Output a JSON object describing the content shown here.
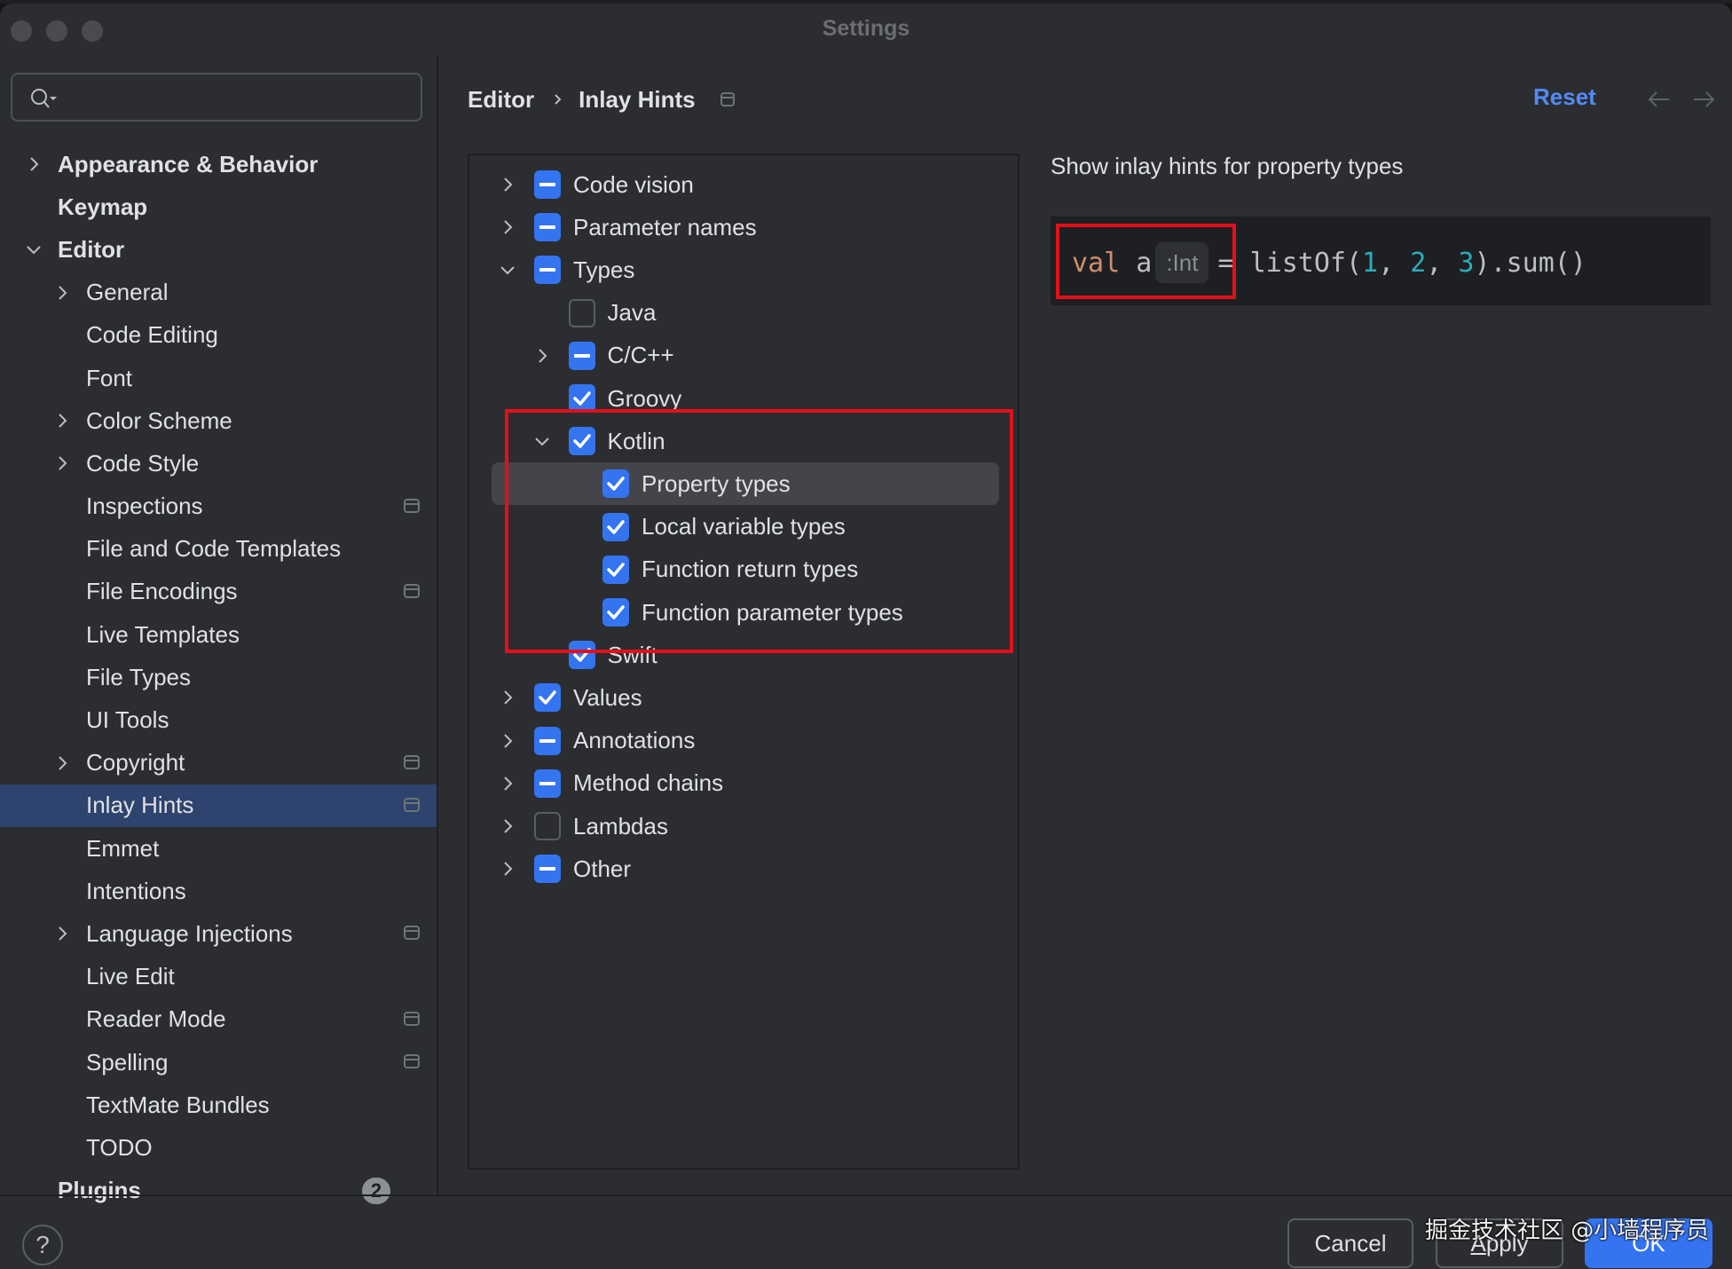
{
  "window": {
    "title": "Settings"
  },
  "search": {
    "value": "",
    "placeholder": ""
  },
  "sidebar": {
    "items": [
      {
        "label": "Appearance & Behavior",
        "level": 0,
        "bold": true,
        "expander": "collapsed",
        "project_icon": false
      },
      {
        "label": "Keymap",
        "level": 0,
        "bold": true,
        "expander": "none",
        "project_icon": false
      },
      {
        "label": "Editor",
        "level": 0,
        "bold": true,
        "expander": "expanded",
        "project_icon": false
      },
      {
        "label": "General",
        "level": 1,
        "bold": false,
        "expander": "collapsed",
        "project_icon": false
      },
      {
        "label": "Code Editing",
        "level": 1,
        "bold": false,
        "expander": "none",
        "project_icon": false
      },
      {
        "label": "Font",
        "level": 1,
        "bold": false,
        "expander": "none",
        "project_icon": false
      },
      {
        "label": "Color Scheme",
        "level": 1,
        "bold": false,
        "expander": "collapsed",
        "project_icon": false
      },
      {
        "label": "Code Style",
        "level": 1,
        "bold": false,
        "expander": "collapsed",
        "project_icon": false
      },
      {
        "label": "Inspections",
        "level": 1,
        "bold": false,
        "expander": "none",
        "project_icon": true
      },
      {
        "label": "File and Code Templates",
        "level": 1,
        "bold": false,
        "expander": "none",
        "project_icon": false
      },
      {
        "label": "File Encodings",
        "level": 1,
        "bold": false,
        "expander": "none",
        "project_icon": true
      },
      {
        "label": "Live Templates",
        "level": 1,
        "bold": false,
        "expander": "none",
        "project_icon": false
      },
      {
        "label": "File Types",
        "level": 1,
        "bold": false,
        "expander": "none",
        "project_icon": false
      },
      {
        "label": "UI Tools",
        "level": 1,
        "bold": false,
        "expander": "none",
        "project_icon": false
      },
      {
        "label": "Copyright",
        "level": 1,
        "bold": false,
        "expander": "collapsed",
        "project_icon": true
      },
      {
        "label": "Inlay Hints",
        "level": 1,
        "bold": false,
        "expander": "none",
        "project_icon": true,
        "selected": true
      },
      {
        "label": "Emmet",
        "level": 1,
        "bold": false,
        "expander": "none",
        "project_icon": false
      },
      {
        "label": "Intentions",
        "level": 1,
        "bold": false,
        "expander": "none",
        "project_icon": false
      },
      {
        "label": "Language Injections",
        "level": 1,
        "bold": false,
        "expander": "collapsed",
        "project_icon": true
      },
      {
        "label": "Live Edit",
        "level": 1,
        "bold": false,
        "expander": "none",
        "project_icon": false
      },
      {
        "label": "Reader Mode",
        "level": 1,
        "bold": false,
        "expander": "none",
        "project_icon": true
      },
      {
        "label": "Spelling",
        "level": 1,
        "bold": false,
        "expander": "none",
        "project_icon": true
      },
      {
        "label": "TextMate Bundles",
        "level": 1,
        "bold": false,
        "expander": "none",
        "project_icon": false
      },
      {
        "label": "TODO",
        "level": 1,
        "bold": false,
        "expander": "none",
        "project_icon": false
      },
      {
        "label": "Plugins",
        "level": 0,
        "bold": true,
        "expander": "none",
        "project_icon": false,
        "badge": "2"
      }
    ]
  },
  "breadcrumb": {
    "parent": "Editor",
    "current": "Inlay Hints"
  },
  "header": {
    "reset_label": "Reset",
    "back_icon": "arrow-left-icon",
    "forward_icon": "arrow-right-icon"
  },
  "tree": {
    "items": [
      {
        "label": "Code vision",
        "level": 0,
        "state": "partial",
        "expander": "collapsed"
      },
      {
        "label": "Parameter names",
        "level": 0,
        "state": "partial",
        "expander": "collapsed"
      },
      {
        "label": "Types",
        "level": 0,
        "state": "partial",
        "expander": "expanded"
      },
      {
        "label": "Java",
        "level": 1,
        "state": "unchecked",
        "expander": "none"
      },
      {
        "label": "C/C++",
        "level": 1,
        "state": "partial",
        "expander": "collapsed"
      },
      {
        "label": "Groovy",
        "level": 1,
        "state": "checked",
        "expander": "none"
      },
      {
        "label": "Kotlin",
        "level": 1,
        "state": "checked",
        "expander": "expanded"
      },
      {
        "label": "Property types",
        "level": 2,
        "state": "checked",
        "expander": "none",
        "selected": true
      },
      {
        "label": "Local variable types",
        "level": 2,
        "state": "checked",
        "expander": "none"
      },
      {
        "label": "Function return types",
        "level": 2,
        "state": "checked",
        "expander": "none"
      },
      {
        "label": "Function parameter types",
        "level": 2,
        "state": "checked",
        "expander": "none"
      },
      {
        "label": "Swift",
        "level": 1,
        "state": "checked",
        "expander": "none"
      },
      {
        "label": "Values",
        "level": 0,
        "state": "checked",
        "expander": "collapsed"
      },
      {
        "label": "Annotations",
        "level": 0,
        "state": "partial",
        "expander": "collapsed"
      },
      {
        "label": "Method chains",
        "level": 0,
        "state": "partial",
        "expander": "collapsed"
      },
      {
        "label": "Lambdas",
        "level": 0,
        "state": "unchecked",
        "expander": "collapsed"
      },
      {
        "label": "Other",
        "level": 0,
        "state": "partial",
        "expander": "collapsed"
      }
    ]
  },
  "detail": {
    "description": "Show inlay hints for property types",
    "code": {
      "keyword": "val",
      "identifier": " a",
      "hint": ":Int",
      "assign": "= listOf(",
      "n1": "1",
      "sep1": ", ",
      "n2": "2",
      "sep2": ", ",
      "n3": "3",
      "tail": ").sum()"
    }
  },
  "footer": {
    "help_label": "?",
    "cancel_label": "Cancel",
    "apply_mnemonic": "A",
    "apply_rest": "pply",
    "ok_label": "OK"
  },
  "watermark": "掘金技术社区 @小墙程序员",
  "colors": {
    "accent": "#3574f0",
    "link": "#548af7",
    "selection": "#2e436e",
    "annotation_red": "#e3101a",
    "keyword": "#cf8e6d",
    "number": "#2aacb8"
  }
}
